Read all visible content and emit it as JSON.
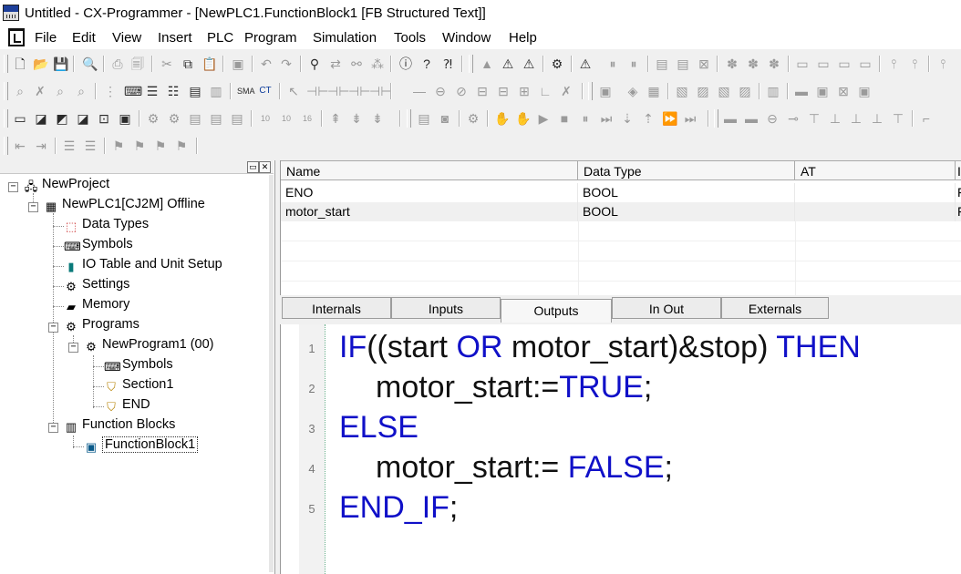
{
  "window": {
    "title": "Untitled - CX-Programmer - [NewPLC1.FunctionBlock1 [FB Structured Text]]"
  },
  "menu": [
    "File",
    "Edit",
    "View",
    "Insert",
    "PLC",
    "Program",
    "Simulation",
    "Tools",
    "Window",
    "Help"
  ],
  "toolbar_icons": {
    "row1": [
      "new-icon",
      "open-icon",
      "save-icon",
      "print-preview-icon",
      "print-icon",
      "preview-icon",
      "cut-icon",
      "copy-icon",
      "paste-icon",
      "clipboard-icon",
      "undo-icon",
      "redo-icon",
      "find-icon",
      "replace-icon",
      "find-replace-icon",
      "address-icon",
      "info-icon",
      "help-icon",
      "whats-this-icon",
      "run-icon",
      "compile-icon",
      "io-icon",
      "monitor-icon",
      "stop-icon",
      "pause-icon",
      "compare-icon"
    ],
    "row2": [
      "zoom-icon",
      "select-icon",
      "zoom-in-icon",
      "zoom-out-icon",
      "grid-icon",
      "symbol-icon",
      "list-icon",
      "table-icon",
      "section-icon",
      "sma-icon",
      "ct-icon",
      "pointer-icon",
      "contact-no-icon",
      "contact-nc-icon",
      "contact-or-icon",
      "coil-icon",
      "line-icon",
      "coil-out-icon",
      "coil-not-icon",
      "instruction-icon",
      "function-icon",
      "vertical-line-icon",
      "delete-icon"
    ],
    "row3": [
      "ladder-view-icon",
      "mnemonic-view-icon",
      "st-view-icon",
      "chart-view-icon",
      "sfc-view-icon",
      "check-icon",
      "io-table-icon",
      "memory-icon",
      "settings-icon",
      "zoom-16-icon",
      "force-on-icon",
      "force-off-icon",
      "transfer-icon",
      "online-icon",
      "play-icon",
      "stop-square-icon",
      "step-icon",
      "step-in-icon",
      "step-out-icon",
      "fast-forward-icon",
      "end-step-icon"
    ],
    "row4": [
      "indent-icon",
      "outdent-icon",
      "comment-icon",
      "uncomment-icon",
      "bookmark-icon",
      "next-bookmark-icon",
      "prev-bookmark-icon",
      "clear-bookmark-icon"
    ]
  },
  "tree": {
    "root": "NewProject",
    "plc": "NewPLC1[CJ2M] Offline",
    "items": {
      "data_types": "Data Types",
      "symbols": "Symbols",
      "io_table": "IO Table and Unit Setup",
      "settings": "Settings",
      "memory": "Memory",
      "programs": "Programs",
      "new_program": "NewProgram1 (00)",
      "prog_symbols": "Symbols",
      "section1": "Section1",
      "end": "END",
      "function_blocks": "Function Blocks",
      "function_block1": "FunctionBlock1"
    }
  },
  "var_table": {
    "columns": [
      "Name",
      "Data Type",
      "AT",
      "I"
    ],
    "rows": [
      {
        "name": "ENO",
        "type": "BOOL",
        "at": "",
        "i": "F"
      },
      {
        "name": "motor_start",
        "type": "BOOL",
        "at": "",
        "i": "F"
      }
    ]
  },
  "tabs": [
    "Internals",
    "Inputs",
    "Outputs",
    "In Out",
    "Externals"
  ],
  "active_tab": "Outputs",
  "code": {
    "line_numbers": [
      "1",
      "2",
      "3",
      "4",
      "5"
    ],
    "l1": {
      "kw1": "IF",
      "t1": "((start ",
      "kw2": "OR",
      "t2": " motor_start)&stop) ",
      "kw3": "THEN"
    },
    "l2": {
      "t1": "motor_start:=",
      "kw1": "TRUE",
      "t2": ";"
    },
    "l3": {
      "kw1": "ELSE"
    },
    "l4": {
      "t1": "motor_start:= ",
      "kw1": "FALSE",
      "t2": ";"
    },
    "l5": {
      "kw1": "END_IF",
      "t1": ";"
    }
  },
  "colors": {
    "keyword": "#1010c8",
    "text": "#111111",
    "selected_row": "#f0f0f0"
  }
}
